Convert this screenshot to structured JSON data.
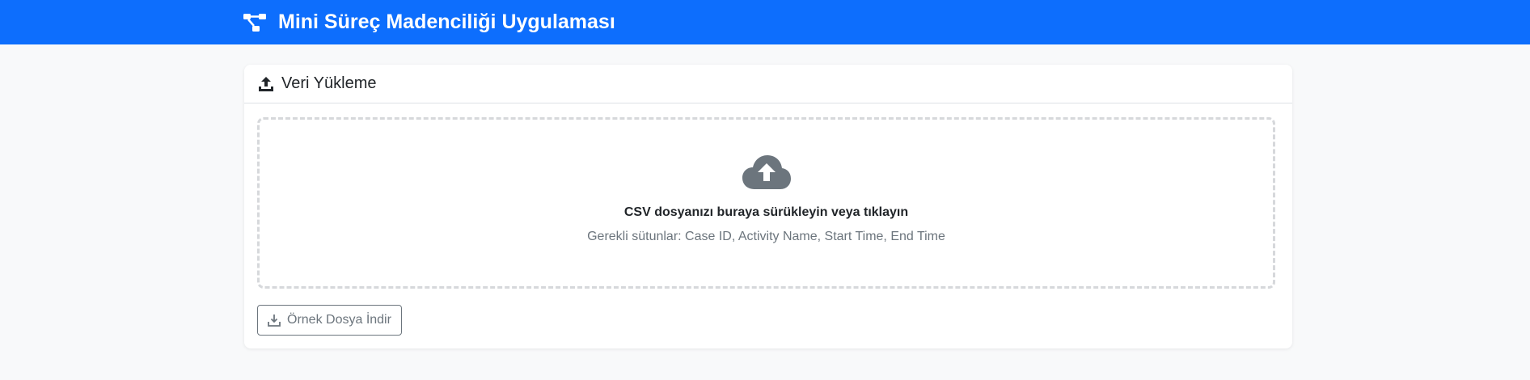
{
  "navbar": {
    "title": "Mini Süreç Madenciliği Uygulaması",
    "icon": "process-flow-icon",
    "color": "#0d6efd"
  },
  "upload_card": {
    "header_icon": "upload-icon",
    "title": "Veri Yükleme",
    "dropzone": {
      "icon": "cloud-upload-icon",
      "title": "CSV dosyanızı buraya sürükleyin veya tıklayın",
      "subtitle": "Gerekli sütunlar: Case ID, Activity Name, Start Time, End Time"
    },
    "download_button": {
      "icon": "download-icon",
      "label": "Örnek Dosya İndir"
    }
  }
}
